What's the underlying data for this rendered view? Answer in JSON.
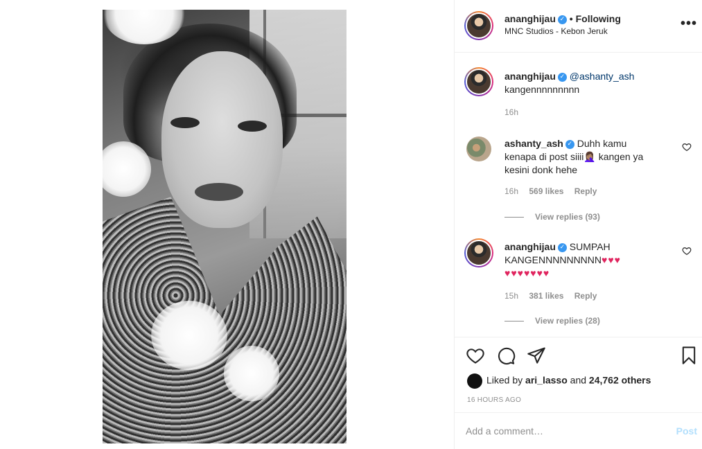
{
  "post": {
    "author": "ananghijau",
    "follow_label": "• Following",
    "location": "MNC Studios - Kebon Jeruk",
    "more_icon": "more-horizontal-icon"
  },
  "caption": {
    "author": "ananghijau",
    "mention": "@ashanty_ash",
    "text": "kangennnnnnnnn",
    "time": "16h"
  },
  "comments": [
    {
      "author": "ashanty_ash",
      "text_line1": "Duhh kamu",
      "text_line2": "kenapa di post siiii🤦🏽‍♀️ kangen ya",
      "text_line3": "kesini donk hehe",
      "time": "16h",
      "likes": "569 likes",
      "reply": "Reply",
      "view_replies": "View replies (93)"
    },
    {
      "author": "ananghijau",
      "text_line1": "SUMPAH",
      "text_line2": "KANGENNNNNNNNN",
      "hearts_line2": "♥♥♥",
      "hearts_line3": "♥♥♥♥♥♥♥",
      "time": "15h",
      "likes": "381 likes",
      "reply": "Reply",
      "view_replies": "View replies (28)"
    }
  ],
  "actions": {
    "liked_by_prefix": "Liked by",
    "liked_by_user": "ari_lasso",
    "liked_by_and": "and",
    "liked_by_count": "24,762 others",
    "timestamp": "16 HOURS AGO"
  },
  "comment_box": {
    "placeholder": "Add a comment…",
    "post_label": "Post"
  },
  "colors": {
    "link": "#00376b",
    "verified": "#3897f0",
    "muted": "#8e8e8e",
    "post_disabled": "#b2dffc",
    "heart": "#e0245e"
  }
}
